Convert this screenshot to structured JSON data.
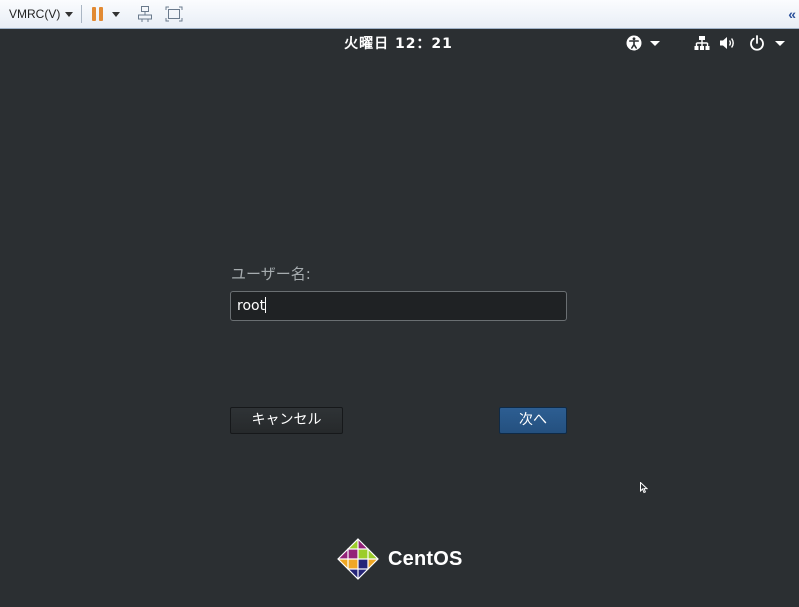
{
  "vmrc": {
    "menu_label": "VMRC(V)",
    "collapse_glyph": "«"
  },
  "topbar": {
    "clock": "火曜日 12：21"
  },
  "login": {
    "username_label": "ユーザー名:",
    "username_value": "root",
    "cancel_label": "キャンセル",
    "next_label": "次へ"
  },
  "branding": {
    "logo_text": "CentOS"
  },
  "colors": {
    "background": "#2b2f32",
    "next_button": "#2a5a8c",
    "pause_icon": "#e28a33"
  }
}
